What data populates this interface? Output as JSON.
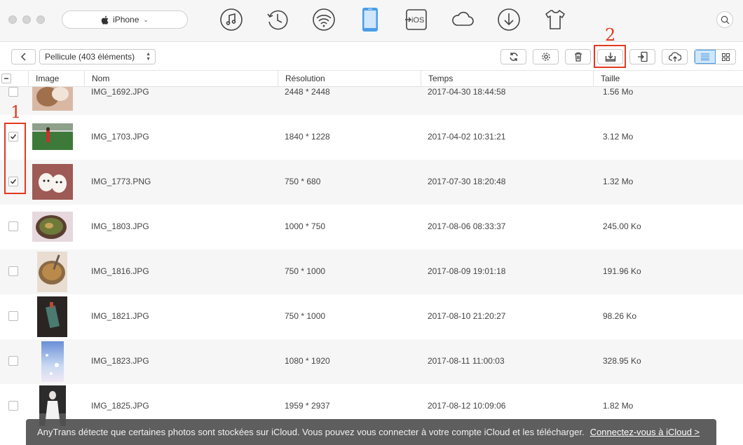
{
  "topbar": {
    "device": "iPhone",
    "nav_icons": [
      "music-icon",
      "history-icon",
      "wifi-icon",
      "iphone-icon",
      "to-ios-icon",
      "cloud-icon",
      "download-icon",
      "tshirt-icon"
    ],
    "to_ios_label": "iOS",
    "active_icon": "iphone-icon",
    "accent": "#4a9ee8"
  },
  "subbar": {
    "album": "Pellicule (403 éléments)",
    "buttons": [
      "refresh-icon",
      "settings-icon",
      "delete-icon",
      "export-to-computer-icon",
      "send-to-device-icon",
      "upload-cloud-icon"
    ],
    "view_modes": [
      "list-view-icon",
      "grid-view-icon"
    ]
  },
  "annotations": {
    "one": "1",
    "two": "2",
    "color": "#e3391f"
  },
  "table": {
    "headers": {
      "image": "Image",
      "name": "Nom",
      "resolution": "Résolution",
      "time": "Temps",
      "size": "Taille"
    },
    "rows": [
      {
        "name": "IMG_1692.JPG",
        "resolution": "2448 * 2448",
        "time": "2017-04-30 18:44:58",
        "size": "1.56 Mo",
        "checked": false
      },
      {
        "name": "IMG_1703.JPG",
        "resolution": "1840 * 1228",
        "time": "2017-04-02 10:31:21",
        "size": "3.12 Mo",
        "checked": true
      },
      {
        "name": "IMG_1773.PNG",
        "resolution": "750 * 680",
        "time": "2017-07-30 18:20:48",
        "size": "1.32 Mo",
        "checked": true
      },
      {
        "name": "IMG_1803.JPG",
        "resolution": "1000 * 750",
        "time": "2017-08-06 08:33:37",
        "size": "245.00 Ko",
        "checked": false
      },
      {
        "name": "IMG_1816.JPG",
        "resolution": "750 * 1000",
        "time": "2017-08-09 19:01:18",
        "size": "191.96 Ko",
        "checked": false
      },
      {
        "name": "IMG_1821.JPG",
        "resolution": "750 * 1000",
        "time": "2017-08-10 21:20:27",
        "size": "98.26 Ko",
        "checked": false
      },
      {
        "name": "IMG_1823.JPG",
        "resolution": "1080 * 1920",
        "time": "2017-08-11 11:00:03",
        "size": "328.95 Ko",
        "checked": false
      },
      {
        "name": "IMG_1825.JPG",
        "resolution": "1959 * 2937",
        "time": "2017-08-12 10:09:06",
        "size": "1.82 Mo",
        "checked": false
      }
    ]
  },
  "notice": {
    "text": "AnyTrans détecte que certaines photos sont stockées sur iCloud. Vous pouvez vous connecter à votre compte iCloud et les télécharger.",
    "link": "Connectez-vous à iCloud >"
  }
}
